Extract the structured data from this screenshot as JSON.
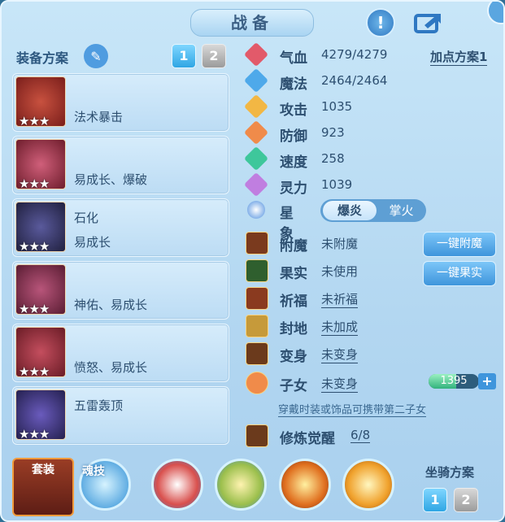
{
  "header": {
    "title": "战备",
    "alert_icon": "exclamation-icon",
    "share_icon": "share-icon"
  },
  "left": {
    "plan_title": "装备方案",
    "plan_buttons": [
      "1",
      "2"
    ],
    "equipment": [
      {
        "line1": "",
        "line2": "法术暴击",
        "stars": "★★★"
      },
      {
        "line1": "",
        "line2": "易成长、爆破",
        "stars": "★★★"
      },
      {
        "line1": "石化",
        "line2": "易成长",
        "stars": "★★★"
      },
      {
        "line1": "",
        "line2": "神佑、易成长",
        "stars": "★★★"
      },
      {
        "line1": "",
        "line2": "愤怒、易成长",
        "stars": "★★★"
      },
      {
        "line1": "五雷轰顶",
        "line2": "",
        "stars": "★★★"
      }
    ]
  },
  "stats": {
    "add_point_plan": "加点方案1",
    "items": [
      {
        "label": "气血",
        "value": "4279/4279"
      },
      {
        "label": "魔法",
        "value": "2464/2464"
      },
      {
        "label": "攻击",
        "value": "1035"
      },
      {
        "label": "防御",
        "value": "923"
      },
      {
        "label": "速度",
        "value": "258"
      },
      {
        "label": "灵力",
        "value": "1039"
      }
    ],
    "star_label": "星象",
    "star_options": [
      "爆炎",
      "掌火"
    ]
  },
  "enhancements": {
    "fumo": {
      "label": "附魔",
      "value": "未附魔",
      "button": "一键附魔"
    },
    "guoshi": {
      "label": "果实",
      "value": "未使用",
      "button": "一键果实"
    },
    "qifu": {
      "label": "祈福",
      "value": "未祈福"
    },
    "fengdi": {
      "label": "封地",
      "value": "未加成"
    },
    "bianshen": {
      "label": "变身",
      "value": "未变身"
    },
    "zinv": {
      "label": "子女",
      "value": "未变身",
      "exp": "1395",
      "note": "穿戴时装或饰品可携带第二子女"
    },
    "xiulian": {
      "label": "修炼觉醒",
      "value": "6/8"
    }
  },
  "bottom": {
    "suit_label": "套装",
    "soul_skill_label": "魂技",
    "mount_plan_title": "坐骑方案",
    "mount_buttons": [
      "1",
      "2"
    ]
  }
}
